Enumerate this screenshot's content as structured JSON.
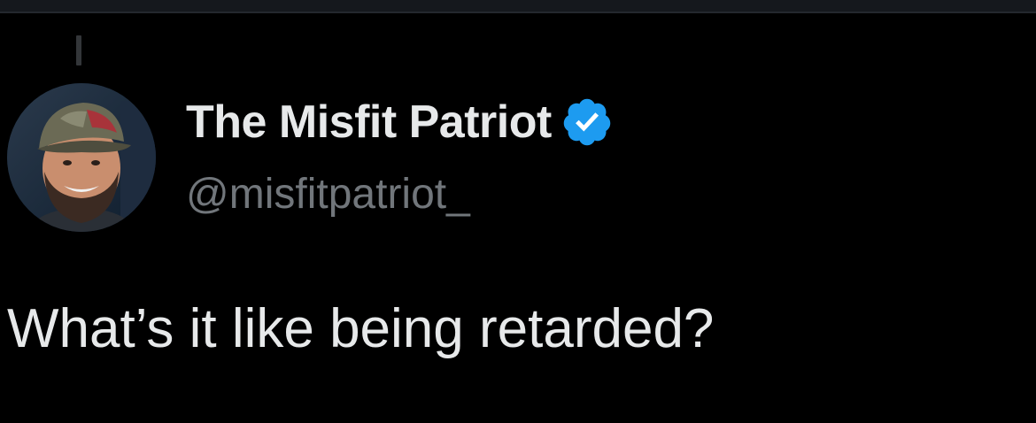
{
  "author": {
    "display_name": "The Misfit Patriot",
    "handle": "@misfitpatriot_",
    "verified": true,
    "avatar_icon": "profile-photo-bearded-man-cap"
  },
  "tweet": {
    "text": "What’s it like being retarded?"
  },
  "colors": {
    "background": "#000000",
    "text_primary": "#e7e9ea",
    "text_secondary": "#71767b",
    "verified_badge": "#1d9bf0"
  }
}
